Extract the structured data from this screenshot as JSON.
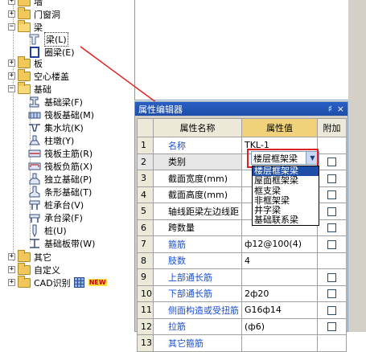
{
  "tree": {
    "items": [
      {
        "label": "墙",
        "kind": "partial"
      },
      {
        "label": "门窗洞",
        "kind": "folder"
      },
      {
        "label": "梁",
        "kind": "folder-open"
      },
      {
        "label": "梁(L)",
        "kind": "beam"
      },
      {
        "label": "圈梁(E)",
        "kind": "ringbeam"
      },
      {
        "label": "板",
        "kind": "folder"
      },
      {
        "label": "空心楼盖",
        "kind": "folder"
      },
      {
        "label": "基础",
        "kind": "folder-open"
      },
      {
        "label": "基础梁(F)",
        "kind": "leaf"
      },
      {
        "label": "筏板基础(M)",
        "kind": "leaf"
      },
      {
        "label": "集水坑(K)",
        "kind": "leaf"
      },
      {
        "label": "柱墩(Y)",
        "kind": "leaf"
      },
      {
        "label": "筏板主筋(R)",
        "kind": "leaf"
      },
      {
        "label": "筏板负筋(X)",
        "kind": "leaf"
      },
      {
        "label": "独立基础(P)",
        "kind": "leaf"
      },
      {
        "label": "条形基础(T)",
        "kind": "leaf"
      },
      {
        "label": "桩承台(V)",
        "kind": "leaf"
      },
      {
        "label": "承台梁(F)",
        "kind": "leaf"
      },
      {
        "label": "桩(U)",
        "kind": "leaf"
      },
      {
        "label": "基础板带(W)",
        "kind": "leaf"
      },
      {
        "label": "其它",
        "kind": "folder"
      },
      {
        "label": "自定义",
        "kind": "folder"
      },
      {
        "label": "CAD识别",
        "kind": "folder"
      }
    ],
    "new_badge": "NEW"
  },
  "prop_editor": {
    "title": "属性编辑器",
    "pin": "♯",
    "close": "×",
    "headers": {
      "name": "属性名称",
      "value": "属性值",
      "add": "附加"
    },
    "rows": [
      {
        "idx": "1",
        "name": "名称",
        "value": "TKL-1",
        "color": "blue",
        "check": false
      },
      {
        "idx": "2",
        "name": "类别",
        "value": "",
        "color": "black",
        "check": true
      },
      {
        "idx": "3",
        "name": "截面宽度(mm)",
        "value": "",
        "color": "black",
        "check": true
      },
      {
        "idx": "4",
        "name": "截面高度(mm)",
        "value": "",
        "color": "black",
        "check": true
      },
      {
        "idx": "5",
        "name": "轴线距梁左边线距",
        "value": "",
        "color": "black",
        "check": true
      },
      {
        "idx": "6",
        "name": "跨数量",
        "value": "",
        "color": "black",
        "check": true
      },
      {
        "idx": "7",
        "name": "箍筋",
        "value": "ф12@100(4)",
        "color": "blue",
        "check": true
      },
      {
        "idx": "8",
        "name": "肢数",
        "value": "4",
        "color": "blue",
        "check": false
      },
      {
        "idx": "9",
        "name": "上部通长筋",
        "value": "",
        "color": "blue",
        "check": true
      },
      {
        "idx": "10",
        "name": "下部通长筋",
        "value": "2ф20",
        "color": "blue",
        "check": true
      },
      {
        "idx": "11",
        "name": "侧面构造或受扭筋",
        "value": "G16ф14",
        "color": "blue",
        "check": true
      },
      {
        "idx": "12",
        "name": "拉筋",
        "value": "(ф6)",
        "color": "blue",
        "check": true
      },
      {
        "idx": "13",
        "name": "其它箍筋",
        "value": "",
        "color": "blue",
        "check": false
      }
    ],
    "combo_value": "楼层框架梁",
    "dropdown_options": [
      "楼层框架梁",
      "屋面框架梁",
      "框支梁",
      "非框架梁",
      "井字梁",
      "基础联系梁"
    ]
  },
  "colors": {
    "highlight": "#1e4ea8",
    "red_box": "#e02020",
    "value_header": "#f0d27a"
  }
}
